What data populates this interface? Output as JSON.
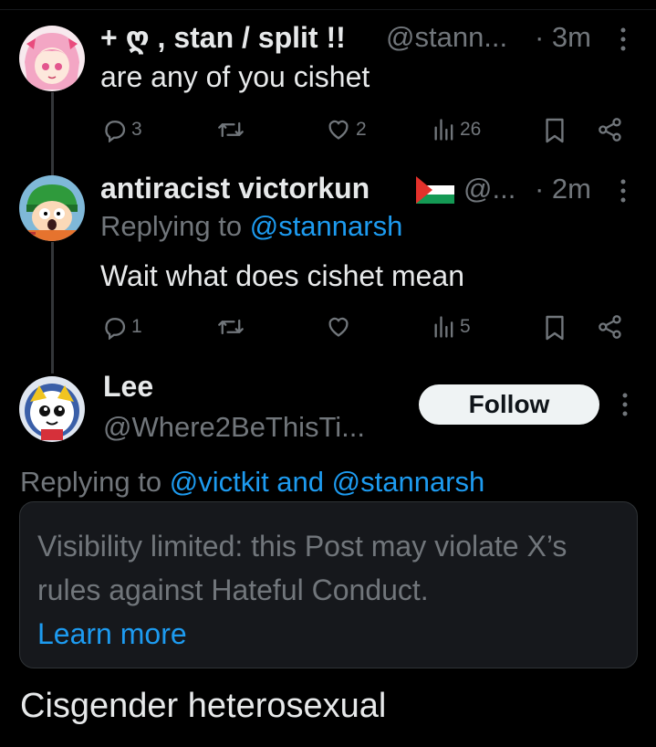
{
  "posts": [
    {
      "display_name": "+ ღ , stan / split !!",
      "handle": "@stann...",
      "time": "· 3m",
      "text": "are any of you cishet",
      "replies": "3",
      "reposts": "",
      "likes": "2",
      "views": "26"
    },
    {
      "display_name": "antiracist victorkun",
      "flag": "🇵🇸",
      "handle": "@...",
      "time": "· 2m",
      "replying_to_label": "Replying to",
      "replying_to": "@stannarsh",
      "text": "Wait what does cishet mean",
      "replies": "1",
      "reposts": "",
      "likes": "",
      "views": "5"
    }
  ],
  "main_post": {
    "display_name": "Lee",
    "handle": "@Where2BeThisTi...",
    "follow_label": "Follow",
    "replying_to_label": "Replying to",
    "replying_to": "@victkit and @stannarsh",
    "notice_text": "Visibility limited: this Post may violate X’s rules against Hateful Conduct.",
    "learn_more": "Learn more",
    "text": "Cisgender heterosexual"
  },
  "colors": {
    "background": "#000000",
    "text": "#e7e9ea",
    "secondary": "#71767b",
    "accent": "#1d9bf0"
  },
  "icons": [
    "reply-icon",
    "repost-icon",
    "like-icon",
    "views-icon",
    "bookmark-icon",
    "share-icon",
    "more-icon",
    "flag-icon"
  ]
}
